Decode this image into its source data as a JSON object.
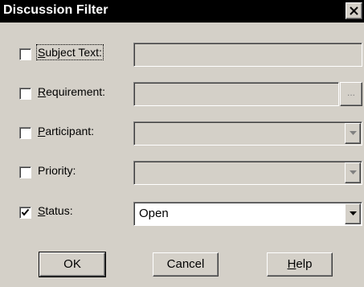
{
  "window": {
    "title": "Discussion Filter",
    "close_icon": "close-x-icon"
  },
  "filters": [
    {
      "key": "subject",
      "checked": false,
      "label_mnemonic": "S",
      "label_rest": "ubject Text:",
      "value": "",
      "control": "text"
    },
    {
      "key": "requirement",
      "checked": false,
      "label_mnemonic": "R",
      "label_rest": "equirement:",
      "value": "",
      "control": "text-browse",
      "browse_label": "..."
    },
    {
      "key": "participant",
      "checked": false,
      "label_mnemonic": "P",
      "label_rest": "articipant:",
      "value": "",
      "control": "dropdown"
    },
    {
      "key": "priority",
      "checked": false,
      "label_mnemonic": "",
      "label_rest": "Priority:",
      "value": "",
      "control": "dropdown"
    },
    {
      "key": "status",
      "checked": true,
      "label_mnemonic": "S",
      "label_rest": "tatus:",
      "value": "Open",
      "control": "dropdown"
    }
  ],
  "buttons": {
    "ok": "OK",
    "cancel": "Cancel",
    "help_mnemonic": "H",
    "help_rest": "elp"
  }
}
